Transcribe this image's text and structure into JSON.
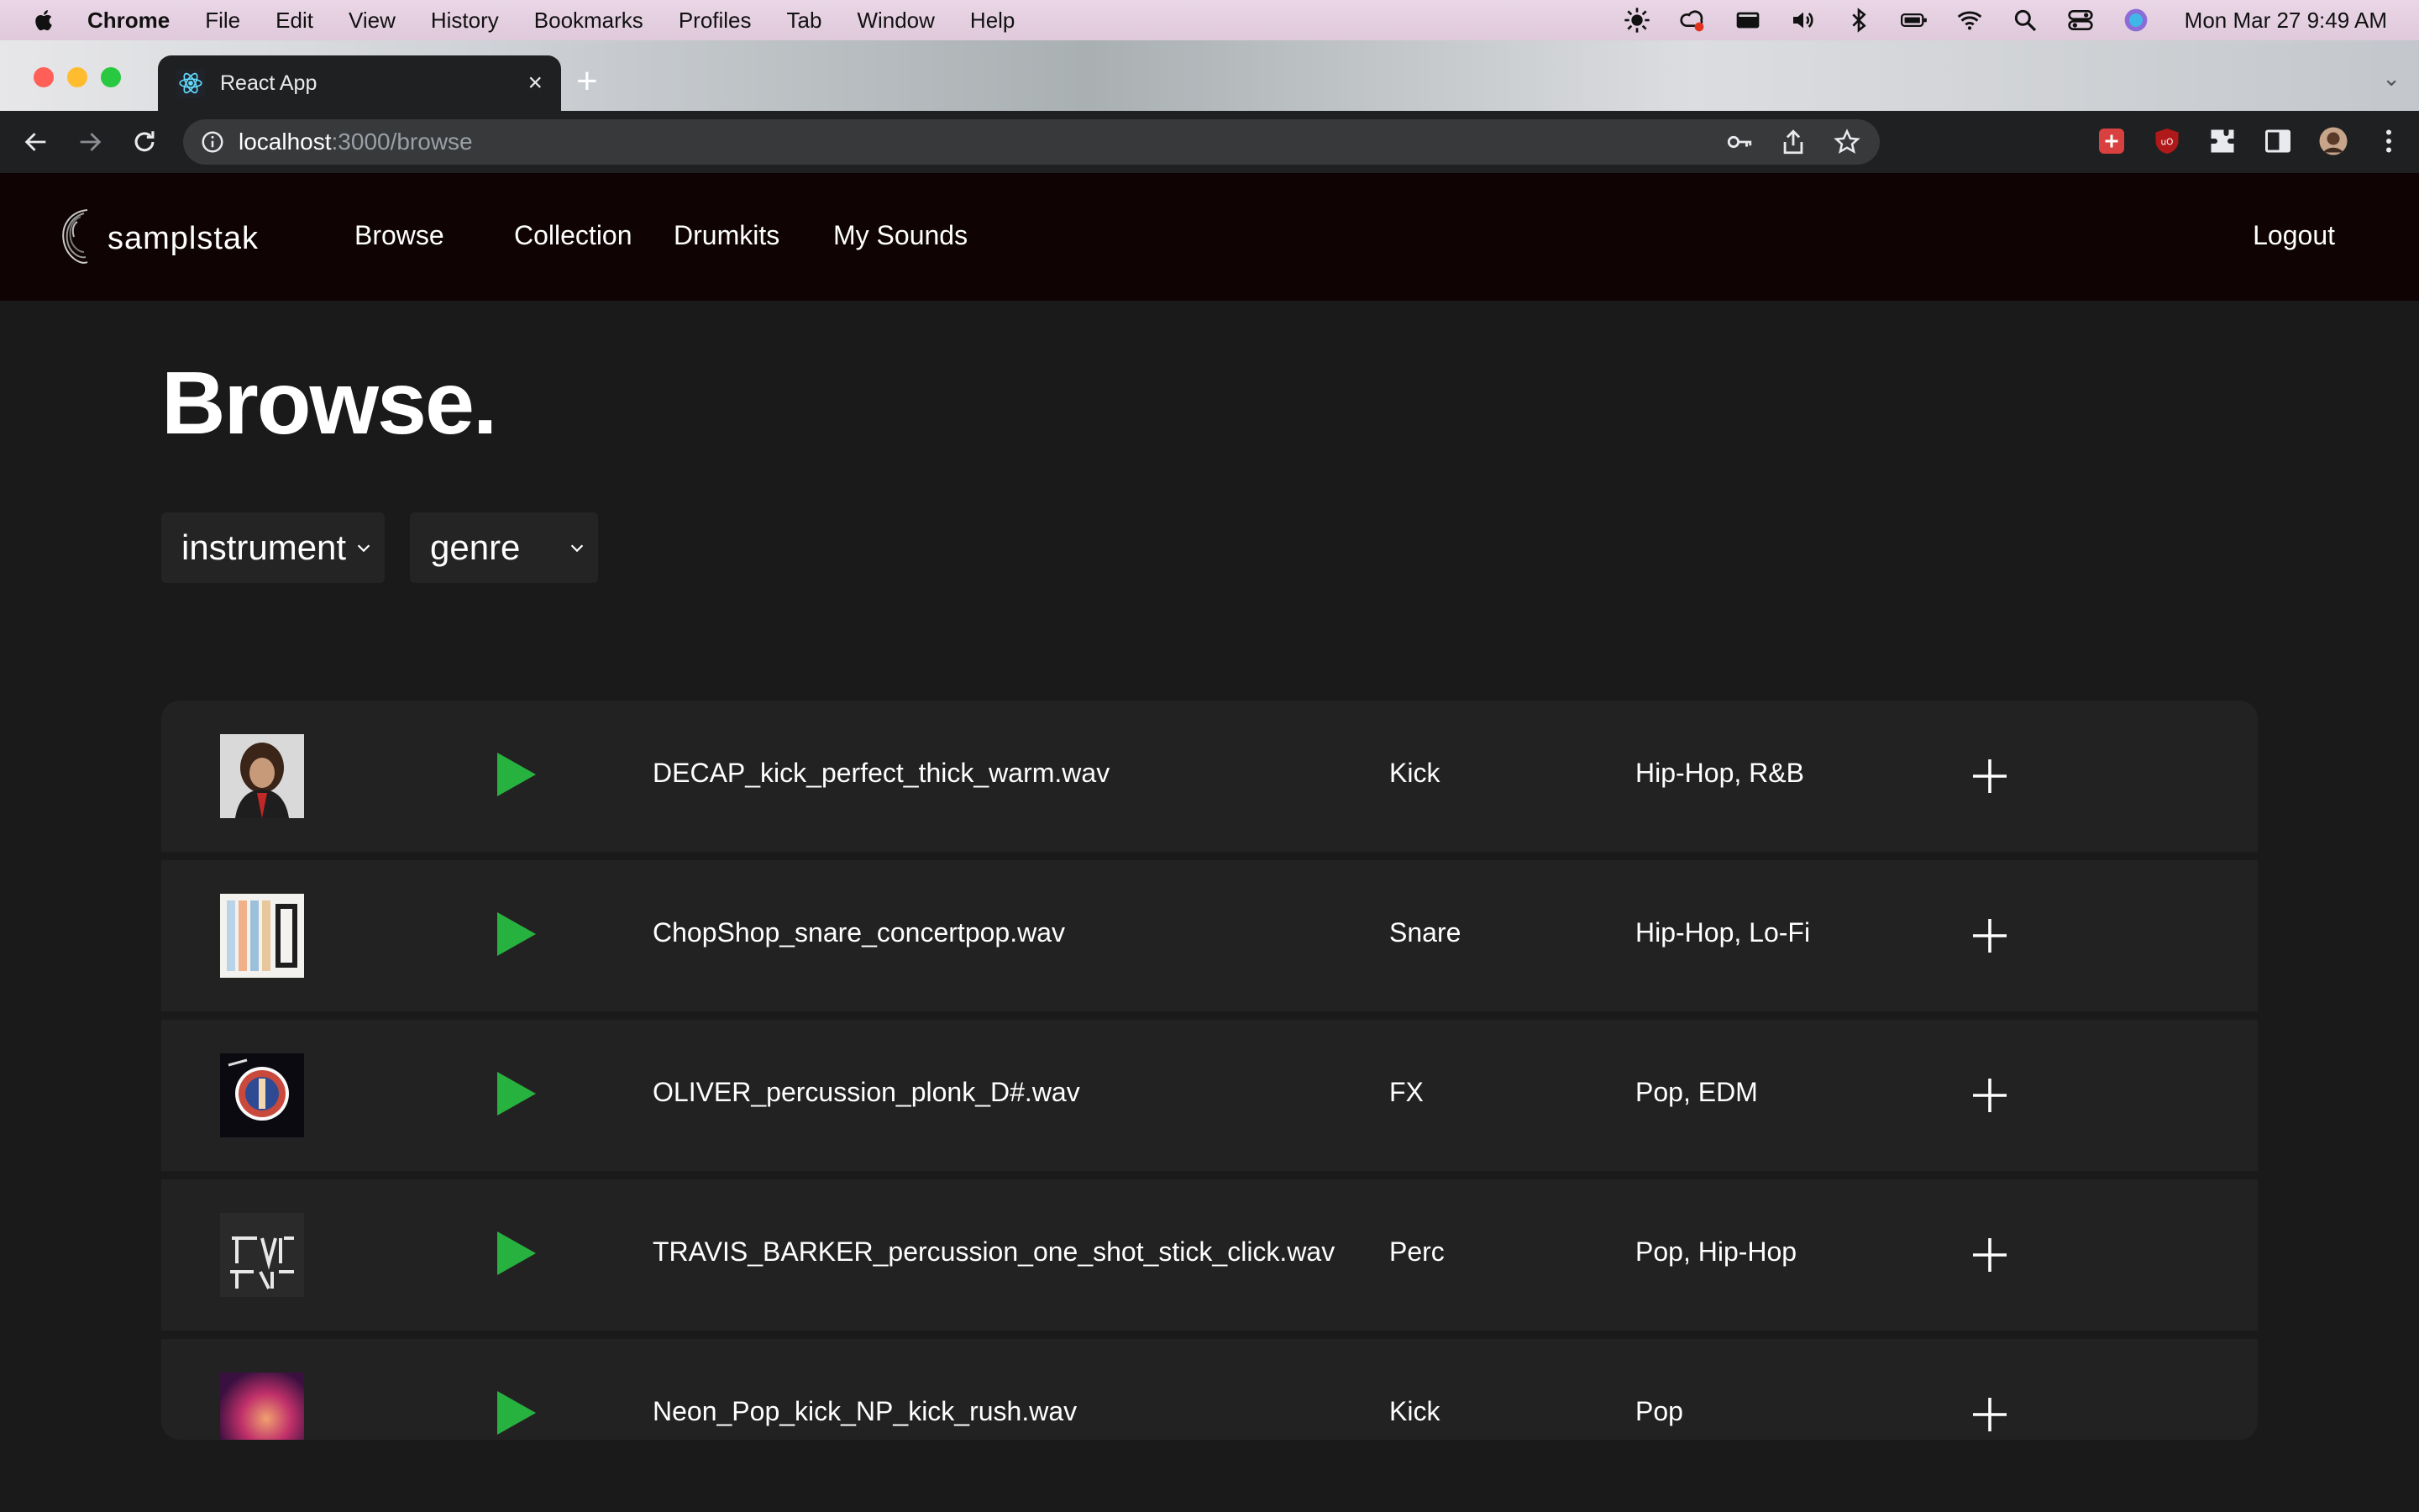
{
  "menubar": {
    "app_name": "Chrome",
    "items": [
      "File",
      "Edit",
      "View",
      "History",
      "Bookmarks",
      "Profiles",
      "Tab",
      "Window",
      "Help"
    ],
    "clock": "Mon Mar 27  9:49 AM"
  },
  "browser": {
    "tab_title": "React App",
    "url_host": "localhost",
    "url_path": ":3000/browse"
  },
  "app": {
    "brand": "samplstak",
    "nav": [
      "Browse",
      "Collection",
      "Drumkits",
      "My Sounds"
    ],
    "logout": "Logout"
  },
  "page": {
    "title": "Browse.",
    "filters": [
      "instrument",
      "genre"
    ]
  },
  "colors": {
    "accent_play": "#27b23f",
    "background": "#1b1a1a",
    "row": "#232222",
    "header": "#0f0303"
  },
  "samples": [
    {
      "file": "DECAP_kick_perfect_thick_warm.wav",
      "instrument": "Kick",
      "genres": "Hip-Hop, R&B",
      "art": "portrait-photo"
    },
    {
      "file": "ChopShop_snare_concertpop.wav",
      "instrument": "Snare",
      "genres": "Hip-Hop, Lo-Fi",
      "art": "chop-shop-cover"
    },
    {
      "file": "OLIVER_percussion_plonk_D#.wav",
      "instrument": "FX",
      "genres": "Pop, EDM",
      "art": "circle-cover"
    },
    {
      "file": "TRAVIS_BARKER_percussion_one_shot_stick_click.wav",
      "instrument": "Perc",
      "genres": "Pop, Hip-Hop",
      "art": "travis-barker-logo"
    },
    {
      "file": "Neon_Pop_kick_NP_kick_rush.wav",
      "instrument": "Kick",
      "genres": "Pop",
      "art": "neon-pop-cover"
    }
  ]
}
